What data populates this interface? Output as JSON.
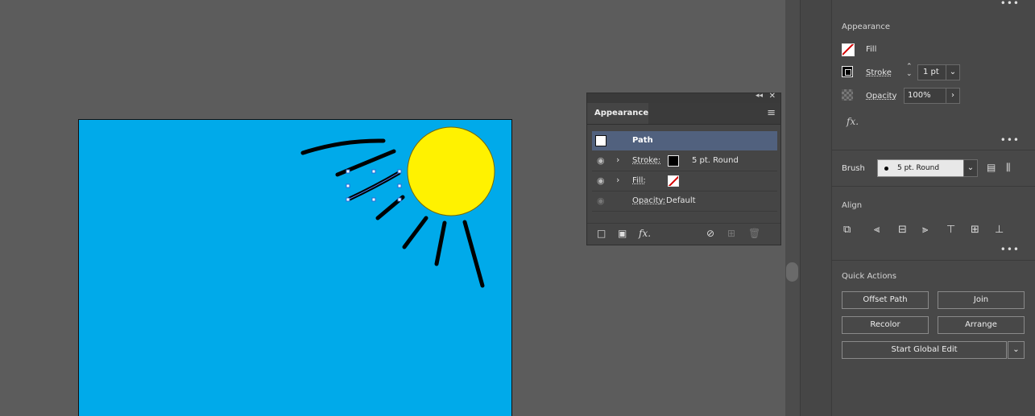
{
  "float_panel": {
    "tab": "Appearance",
    "target": "Path",
    "rows": [
      {
        "label": "Stroke:",
        "value": "5 pt. Round"
      },
      {
        "label": "Fill:",
        "value": ""
      },
      {
        "label": "Opacity:",
        "value": "Default"
      }
    ],
    "fx": "fx."
  },
  "right_panel": {
    "appearance_title": "Appearance",
    "fill_label": "Fill",
    "stroke_label": "Stroke",
    "stroke_weight": "1 pt",
    "opacity_label": "Opacity",
    "opacity_value": "100%",
    "fx": "fx.",
    "brush_label": "Brush",
    "brush_value": "5 pt. Round",
    "align_title": "Align",
    "quick_title": "Quick Actions",
    "btn_offset": "Offset Path",
    "btn_join": "Join",
    "btn_recolor": "Recolor",
    "btn_arrange": "Arrange",
    "btn_global": "Start Global Edit"
  },
  "colors": {
    "artboard": "#00aaea",
    "sun": "#fff200",
    "selection": "#2a6bd6"
  }
}
